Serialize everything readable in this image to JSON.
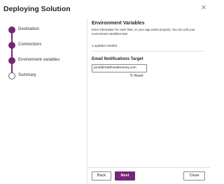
{
  "dialog": {
    "title": "Deploying Solution",
    "close_icon": "close-icon"
  },
  "steps": [
    {
      "label": "Destination",
      "state": "completed"
    },
    {
      "label": "Connections",
      "state": "completed"
    },
    {
      "label": "Environment variables",
      "state": "current"
    },
    {
      "label": "Summary",
      "state": "pending"
    }
  ],
  "panel": {
    "title": "Environment Variables",
    "description": "Enter information for each field, so your app works properly. You can edit your environment variables later.",
    "updates_needed": "1 updates needed",
    "field": {
      "label": "Email Notifications Target",
      "value": "prod@matthewdevaney.com"
    },
    "reset_label": "Reset",
    "reset_icon": "reset-icon"
  },
  "footer": {
    "back_label": "Back",
    "next_label": "Next",
    "close_label": "Close"
  },
  "colors": {
    "accent": "#742774",
    "border": "#8a8886",
    "divider": "#e1dfdd"
  }
}
